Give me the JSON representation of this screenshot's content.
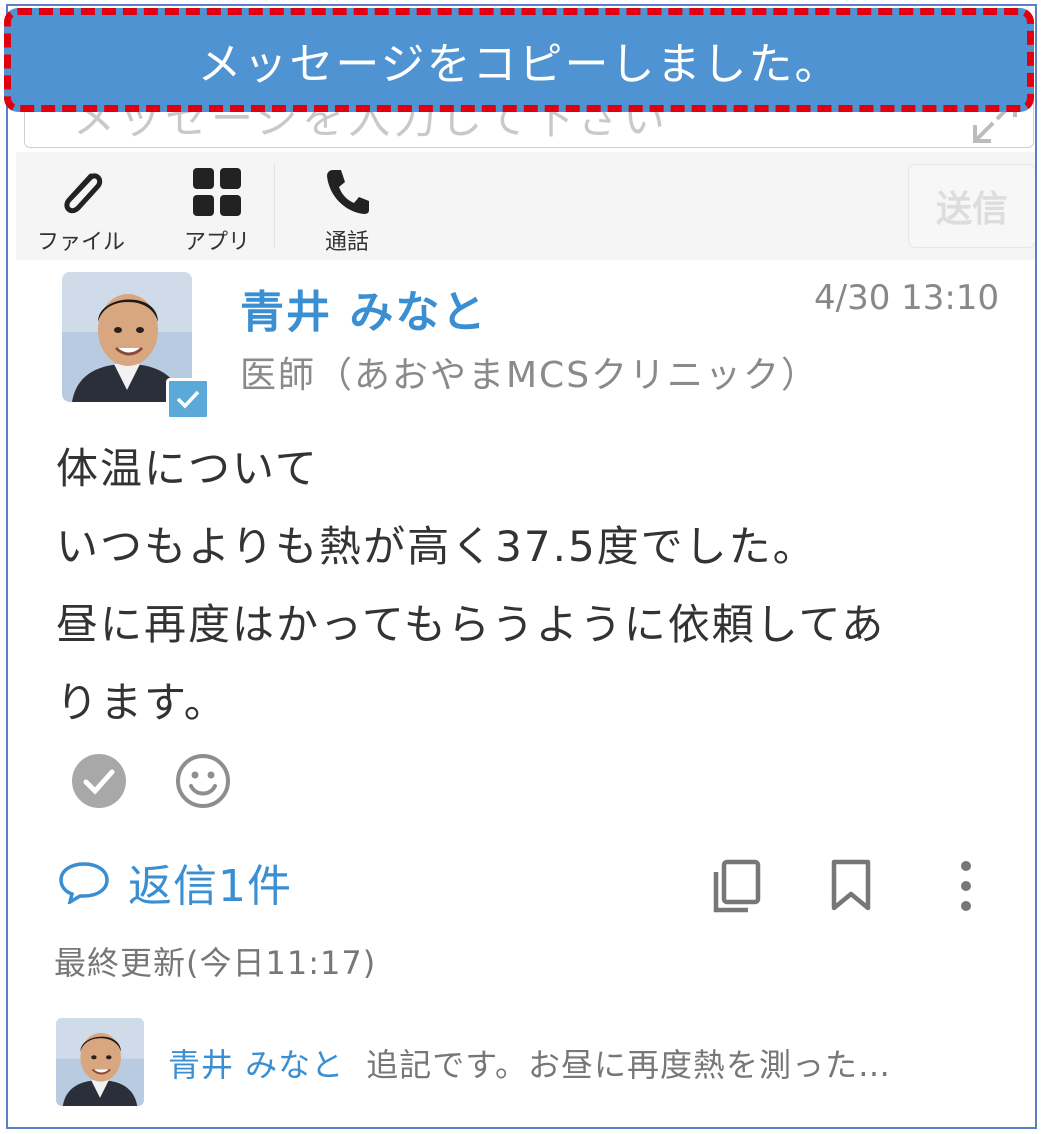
{
  "toast": {
    "message": "メッセージをコピーしました。"
  },
  "composer": {
    "placeholder": "メッセージを入力して下さい"
  },
  "toolbar": {
    "file_label": "ファイル",
    "apps_label": "アプリ",
    "call_label": "通話",
    "send_label": "送信"
  },
  "message": {
    "sender_name": "青井 みなと",
    "timestamp": "4/30 13:10",
    "sender_role": "医師（あおやまMCSクリニック）",
    "body_lines": [
      "体温について",
      "いつもよりも熱が高く37.5度でした。",
      "昼に再度はかってもらうように依頼してあ",
      "ります。"
    ],
    "reply_label": "返信1件",
    "last_updated": "最終更新(今日11:17)"
  },
  "reply_preview": {
    "author": "青井 みなと",
    "snippet": "追記です。お昼に再度熱を測った…"
  },
  "colors": {
    "accent": "#3a8fd3",
    "toast_bg": "#4f93d2",
    "toast_border": "#e00010",
    "verified": "#5aa9d8"
  },
  "icons": [
    "paperclip-icon",
    "apps-grid-icon",
    "phone-icon",
    "expand-icon",
    "check-circle-icon",
    "smile-icon",
    "speech-bubble-icon",
    "copy-icon",
    "bookmark-icon",
    "more-vertical-icon"
  ]
}
